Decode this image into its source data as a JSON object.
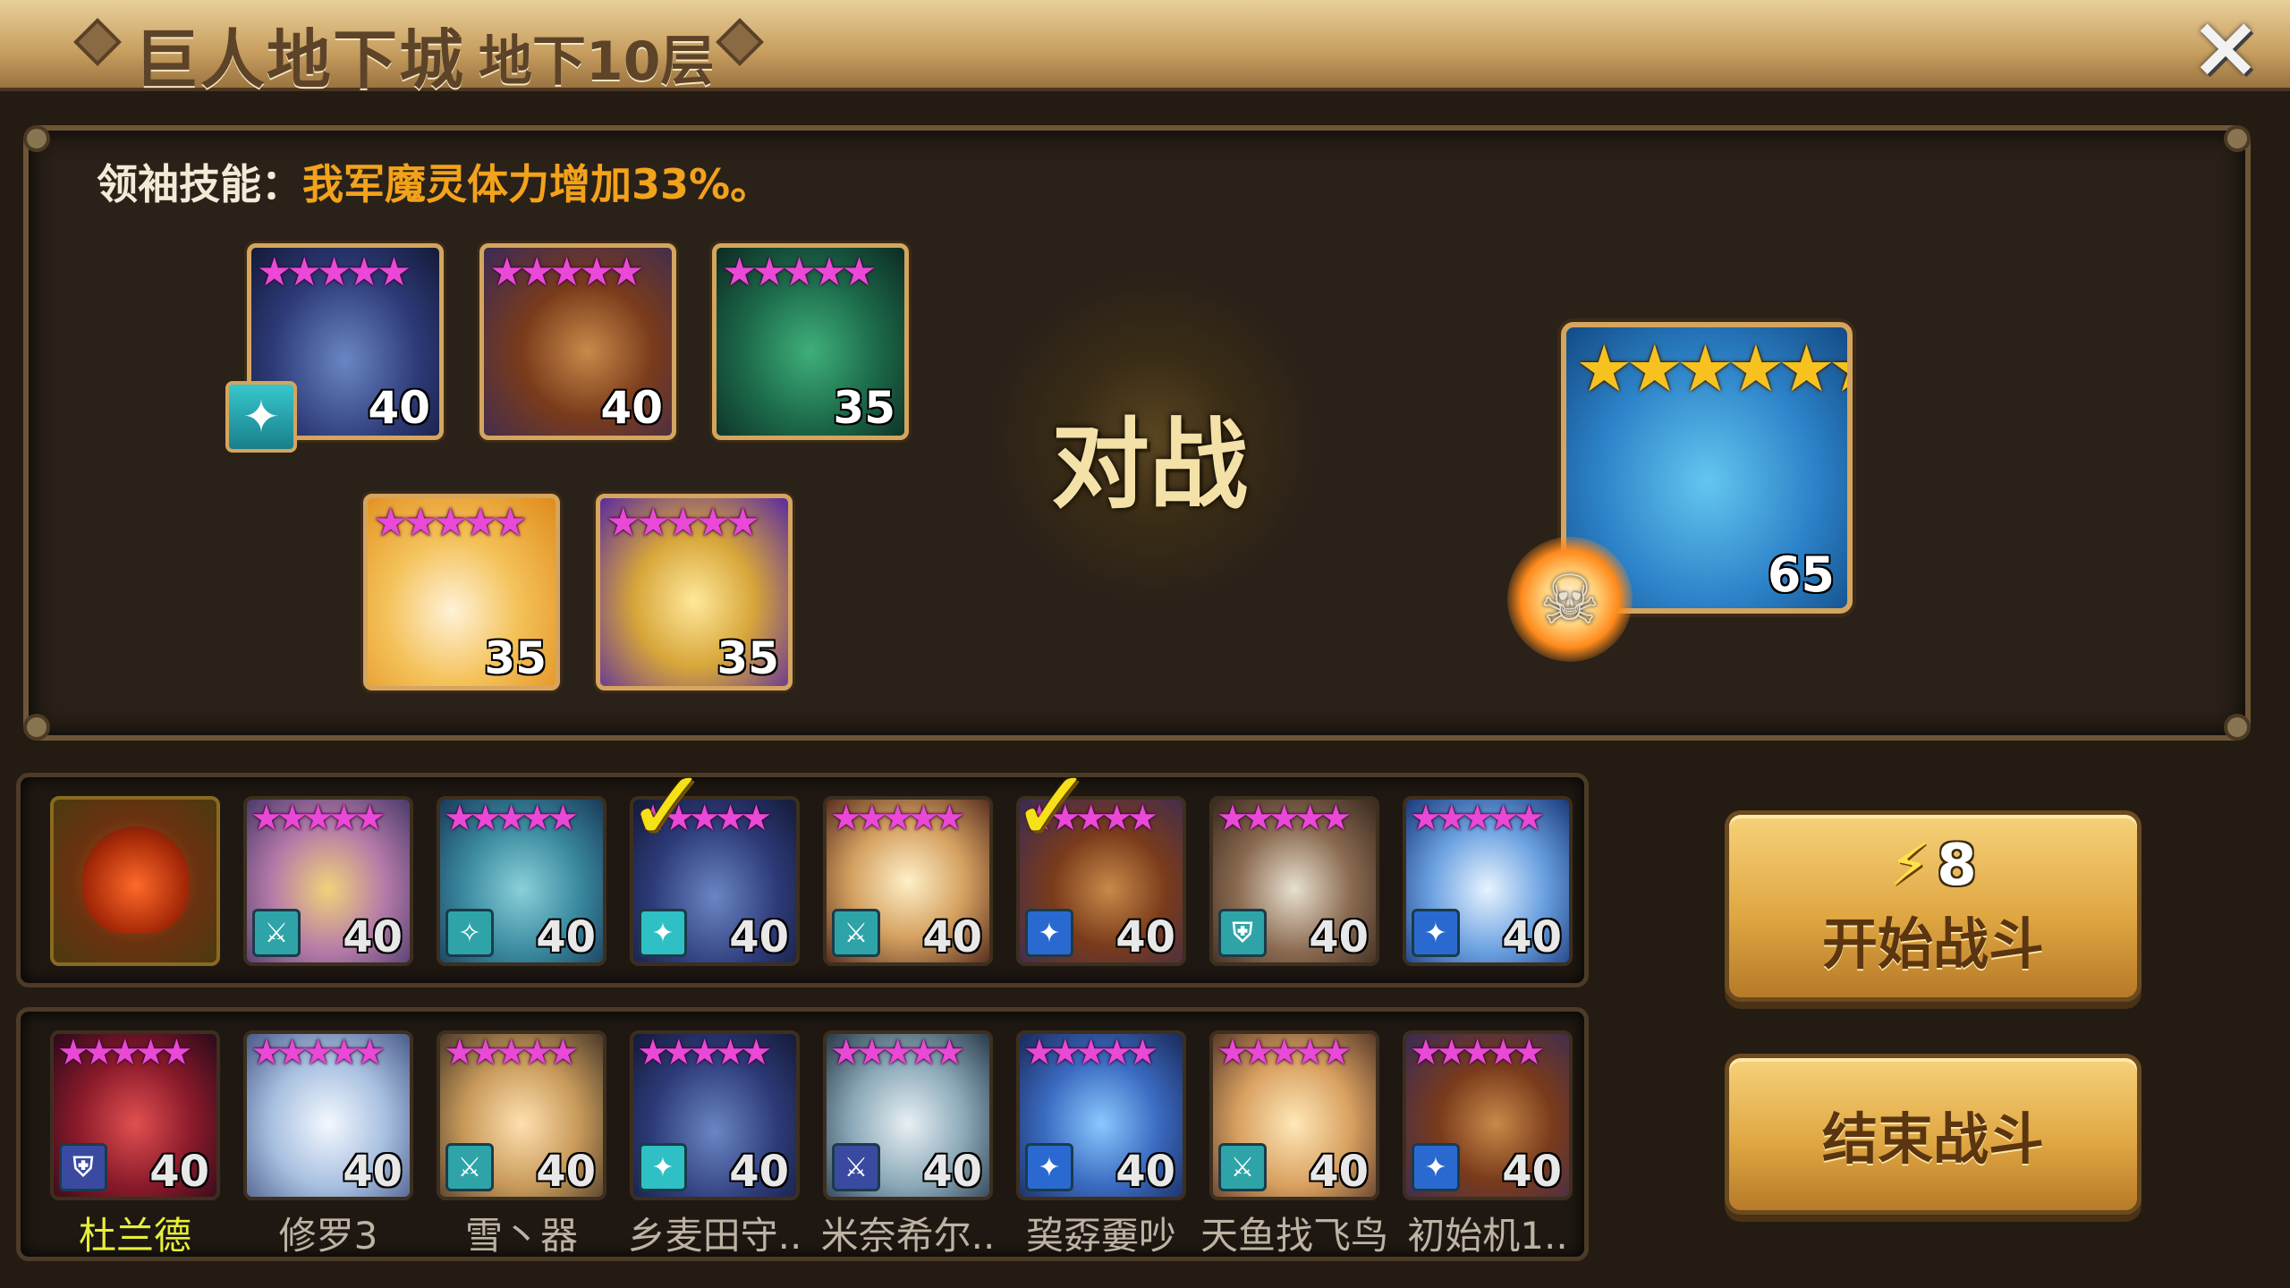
{
  "header": {
    "title": "巨人地下城",
    "floor": "地下10层",
    "close_icon": "×"
  },
  "leader_skill": {
    "label": "领袖技能：",
    "value": "我军魔灵体力增加33%。"
  },
  "vs_label": "对战",
  "team": [
    {
      "stars": "★★★★★",
      "level": "40",
      "leader": true,
      "leader_icon": "✦"
    },
    {
      "stars": "★★★★★",
      "level": "40"
    },
    {
      "stars": "★★★★★",
      "level": "35"
    },
    {
      "stars": "★★★★★",
      "level": "35"
    },
    {
      "stars": "★★★★★",
      "level": "35"
    }
  ],
  "boss": {
    "stars": "★★★★★★",
    "level": "65",
    "skull_icon": "☠"
  },
  "roster_row1": [
    {
      "level": "",
      "stars": ""
    },
    {
      "stars": "★★★★★",
      "level": "40",
      "attr": "⚔"
    },
    {
      "stars": "★★★★★",
      "level": "40",
      "attr": "✧"
    },
    {
      "stars": "★★★★★",
      "level": "40",
      "attr": "✦",
      "selected": true
    },
    {
      "stars": "★★★★★",
      "level": "40",
      "attr": "⚔"
    },
    {
      "stars": "★★★★★",
      "level": "40",
      "attr": "✦",
      "selected": true
    },
    {
      "stars": "★★★★★",
      "level": "40",
      "attr": "⛨"
    },
    {
      "stars": "★★★★★",
      "level": "40",
      "attr": "✦"
    }
  ],
  "roster_row2": [
    {
      "stars": "★★★★★",
      "level": "40",
      "attr": "⛨",
      "name": "杜兰德"
    },
    {
      "stars": "★★★★★",
      "level": "40",
      "attr": "",
      "name": "修罗3"
    },
    {
      "stars": "★★★★★",
      "level": "40",
      "attr": "⚔",
      "name": "雪丶器"
    },
    {
      "stars": "★★★★★",
      "level": "40",
      "attr": "✦",
      "name": "乡麦田守.."
    },
    {
      "stars": "★★★★★",
      "level": "40",
      "attr": "⚔",
      "name": "米奈希尔.."
    },
    {
      "stars": "★★★★★",
      "level": "40",
      "attr": "✦",
      "name": "巭孬嫑吵"
    },
    {
      "stars": "★★★★★",
      "level": "40",
      "attr": "⚔",
      "name": "天鱼找飞鸟"
    },
    {
      "stars": "★★★★★",
      "level": "40",
      "attr": "✦",
      "name": "初始机1.."
    }
  ],
  "buttons": {
    "energy_icon": "⚡",
    "energy_cost": "8",
    "start_label": "开始战斗",
    "end_label": "结束战斗"
  },
  "colors": {
    "leader_value": "#f2a21b",
    "selected_name": "#e6f03a",
    "star_magenta": "#ea48d6",
    "star_gold": "#f7c21f",
    "check": "#f6e018"
  }
}
